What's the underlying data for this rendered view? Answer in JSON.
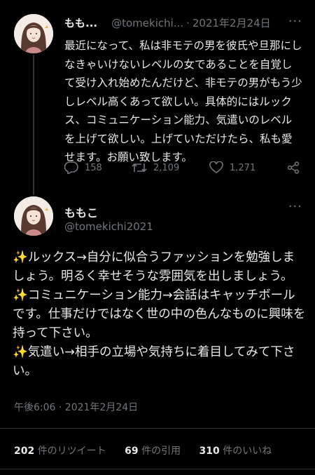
{
  "tweet1": {
    "name": "もも...",
    "handle": "@tomekichi...",
    "separator": "·",
    "date": "2021年2月24日",
    "more": "···",
    "text": "最近になって、私は非モテの男を彼氏や旦那にしなきゃいけないレベルの女であることを自覚して受け入れ始めたんだけど、非モテの男がもう少しレベル高くあって欲しい。具体的にはルックス、コミュニケーション能力、気遣いのレベルを上げて欲しい。上げていただけたら、私も愛せます。お願い致します。",
    "replies": "158",
    "retweets": "2,109",
    "likes": "1,271"
  },
  "tweet2": {
    "name": "ももこ",
    "handle": "@tomekichi2021",
    "more": "···",
    "sparkle": "✨",
    "line1": "ルックス→自分に似合うファッションを勉強しましょう。明るく幸せそうな雰囲気を出しましょう。",
    "line2": "コミュニケーション能力→会話はキャッチボールです。仕事だけではなく世の中の色んなものに興味を持って下さい。",
    "line3": "気遣い→相手の立場や気持ちに着目してみて下さい。",
    "timestamp": "午後6:06 · 2021年2月24日"
  },
  "stats": {
    "retweets_count": "202",
    "retweets_label": "件のリツイート",
    "quotes_count": "69",
    "quotes_label": "件の引用",
    "likes_count": "310",
    "likes_label": "件のいいね"
  },
  "colors": {
    "background": "#000000",
    "text": "#e7e9ea",
    "muted": "#71767b",
    "sparkle": "#f5c400"
  }
}
